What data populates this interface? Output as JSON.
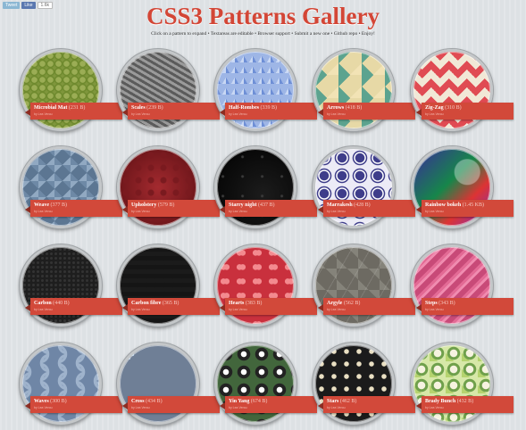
{
  "share": {
    "tweet": "Tweet",
    "like": "Like",
    "count": "1.6k"
  },
  "title": "CSS3 Patterns Gallery",
  "subtitle": "Click on a pattern to expand • Textareas are editable • Browser support • Submit a new one • Github repo • Enjoy!",
  "patterns": [
    {
      "name": "Microbial Mat",
      "size": "(231 B)",
      "author": "by Lea Verou"
    },
    {
      "name": "Scales",
      "size": "(239 B)",
      "author": "by Lea Verou"
    },
    {
      "name": "Half-Rombes",
      "size": "(339 B)",
      "author": "by Lea Verou"
    },
    {
      "name": "Arrows",
      "size": "(418 B)",
      "author": "by Lea Verou"
    },
    {
      "name": "Zig-Zag",
      "size": "(310 B)",
      "author": "by Lea Verou"
    },
    {
      "name": "Weave",
      "size": "(377 B)",
      "author": "by Lea Verou"
    },
    {
      "name": "Upholstery",
      "size": "(579 B)",
      "author": "by Lea Verou"
    },
    {
      "name": "Starry night",
      "size": "(437 B)",
      "author": "by Lea Verou"
    },
    {
      "name": "Marrakesh",
      "size": "(428 B)",
      "author": "by Lea Verou"
    },
    {
      "name": "Rainbow bokeh",
      "size": "(1.45 KB)",
      "author": "by Lea Verou"
    },
    {
      "name": "Carbon",
      "size": "(440 B)",
      "author": "by Lea Verou"
    },
    {
      "name": "Carbon fibre",
      "size": "(365 B)",
      "author": "by Lea Verou"
    },
    {
      "name": "Hearts",
      "size": "(383 B)",
      "author": "by Lea Verou"
    },
    {
      "name": "Argyle",
      "size": "(562 B)",
      "author": "by Lea Verou"
    },
    {
      "name": "Steps",
      "size": "(343 B)",
      "author": "by Lea Verou"
    },
    {
      "name": "Waves",
      "size": "(300 B)",
      "author": "by Lea Verou"
    },
    {
      "name": "Cross",
      "size": "(434 B)",
      "author": "by Lea Verou"
    },
    {
      "name": "Yin Yang",
      "size": "(674 B)",
      "author": "by Lea Verou"
    },
    {
      "name": "Stars",
      "size": "(462 B)",
      "author": "by Lea Verou"
    },
    {
      "name": "Brady Bunch",
      "size": "(432 B)",
      "author": "by Lea Verou"
    }
  ],
  "colors": {
    "title": "#d34636",
    "label": "#d2493a",
    "background": "#dde1e4"
  }
}
